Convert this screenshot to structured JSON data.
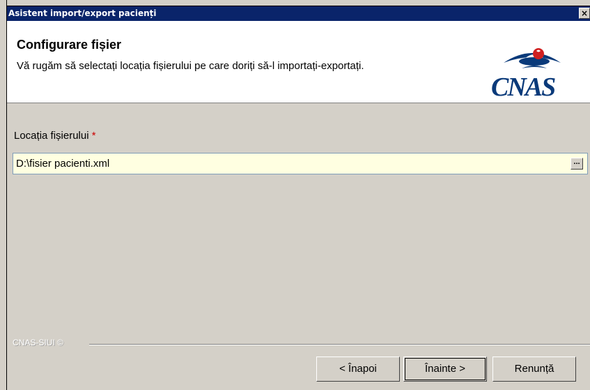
{
  "window": {
    "title": "Asistent import/export pacienți",
    "close_glyph": "×"
  },
  "header": {
    "title": "Configurare fișier",
    "subtitle": "Vă rugăm să selectați locația fișierului pe care doriți să-l importați-exportați.",
    "logo_text": "CNAS",
    "logo_icon": "cnas-logo-icon"
  },
  "form": {
    "file_label": "Locația fișierului",
    "required_marker": "*",
    "file_value": "D:\\fisier pacienti.xml",
    "browse_glyph": "..."
  },
  "footer": {
    "brand": "CNAS-SIUI ©",
    "back_label": "< Înapoi",
    "next_label": "Înainte >",
    "cancel_label": "Renunță"
  },
  "colors": {
    "titlebar": "#0a246a",
    "input_bg": "#ffffe1",
    "required": "#cc0000",
    "logo": "#0a3a7a"
  }
}
